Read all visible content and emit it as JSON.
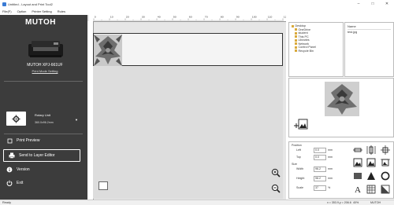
{
  "window": {
    "title": "Untitled - Layout and Print Tool2",
    "minimize": "–",
    "maximize": "□",
    "close": "✕"
  },
  "menu": [
    "File(F)",
    "Option",
    "Printer Setting",
    "Rules"
  ],
  "sidebar": {
    "logo": "MUTOH",
    "printer_name": "MUTOH XPJ-661UF",
    "print_mode_link": "Print Mode Setting",
    "rotary_label": "Rotary Unit",
    "rotary_value": "360.0x96.2mm",
    "buttons": {
      "print_preview": "Print Preview",
      "send_to_layer_editor": "Send to Layer Editor",
      "version": "Version",
      "exit": "Exit"
    }
  },
  "ruler": {
    "top_ticks": [
      "0",
      "10",
      "20",
      "30",
      "40",
      "50",
      "60",
      "70",
      "80",
      "90",
      "100",
      "110",
      "120"
    ]
  },
  "file_browser": {
    "tree": [
      "Desktop",
      "OneDrive",
      "student",
      "This PC",
      "Libraries",
      "Network",
      "Control Panel",
      "Recycle Bin"
    ],
    "list_header": "Name",
    "files": [
      "test.jpg"
    ]
  },
  "properties": {
    "position_label": "Position",
    "left_label": "Left",
    "left_value": "0.0",
    "top_label": "Top",
    "top_value": "0.0",
    "size_label": "Size",
    "width_label": "Width",
    "width_value": "96.2",
    "height_label": "Height",
    "height_value": "96.2",
    "scale_label": "Scale",
    "scale_value": "37",
    "unit_mm": "mm",
    "unit_percent": "%"
  },
  "status": {
    "left": "Ready",
    "coords": "x = 353.9,y = 206.6",
    "zoom": "40%",
    "mode": "MUTOH"
  },
  "colors": {
    "sidebar_bg": "#3c3c3c",
    "canvas_bg": "#e6e6e6",
    "accent_blue": "#3a7bd5"
  }
}
